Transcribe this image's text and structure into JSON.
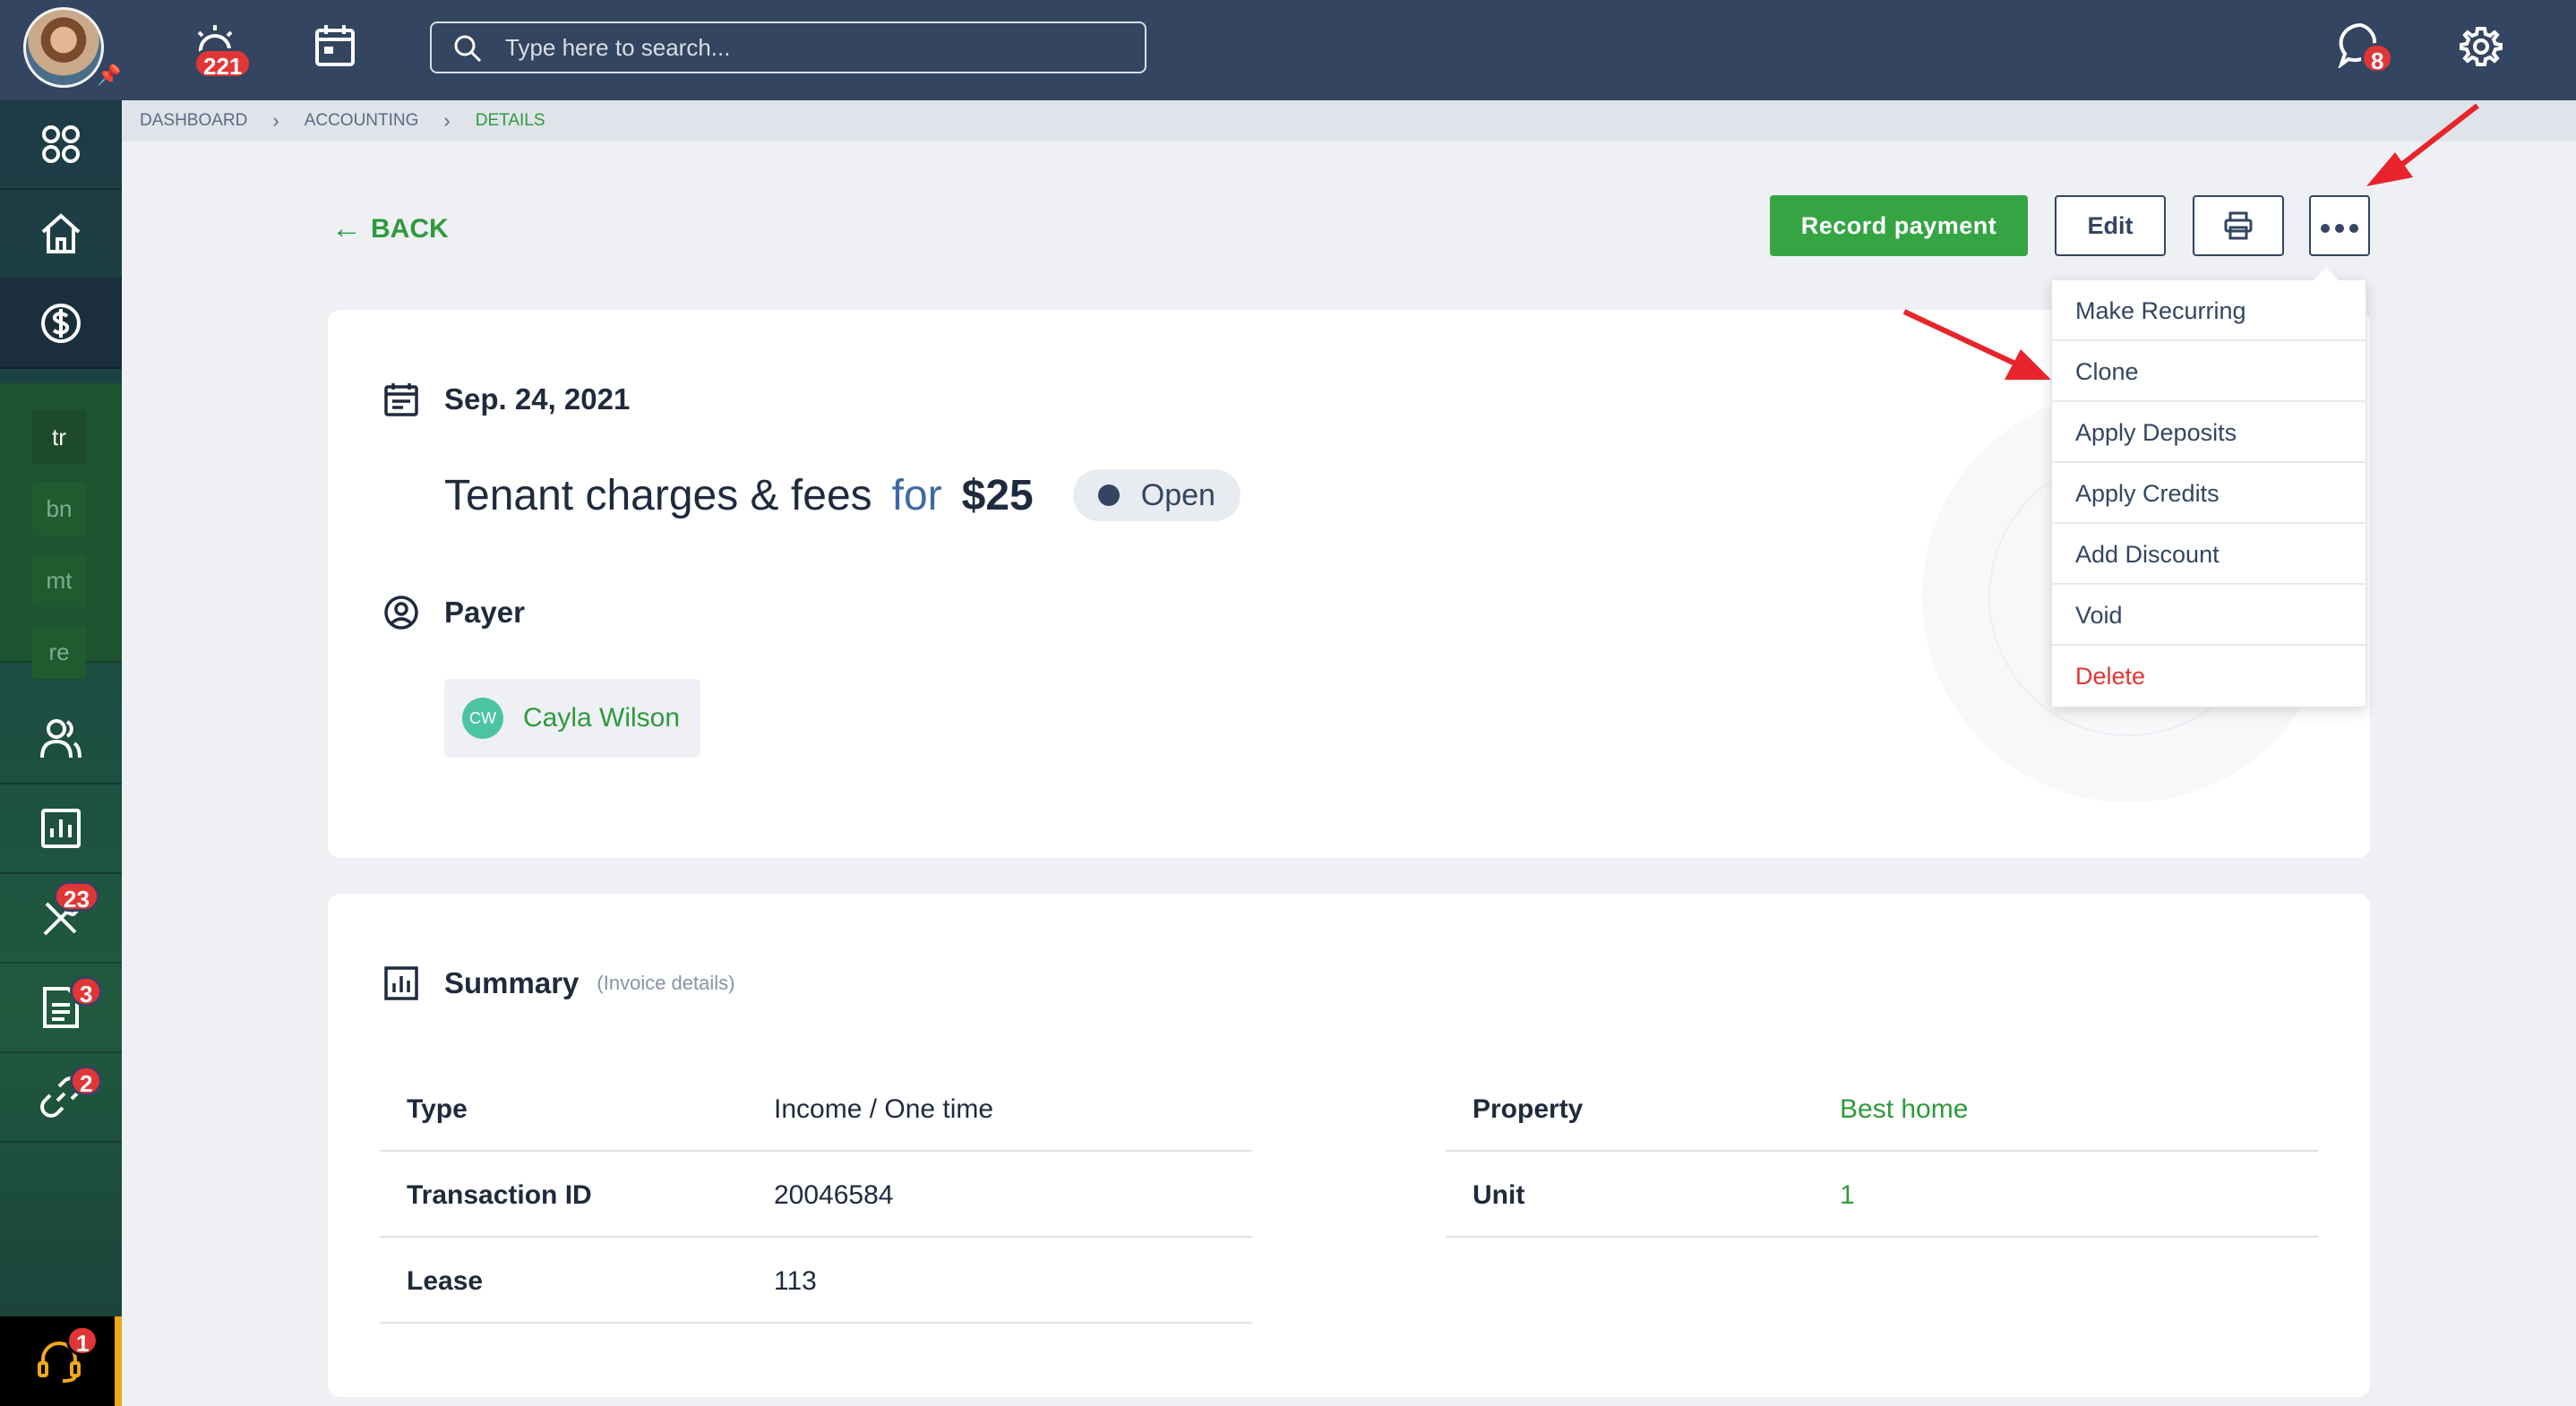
{
  "topbar": {
    "alerts_count": "221",
    "messages_count": "8",
    "search_placeholder": "Type here to search..."
  },
  "sidebar": {
    "tags": [
      "tr",
      "bn",
      "mt",
      "re"
    ],
    "maintenance_count": "23",
    "documents_count": "3",
    "links_count": "2",
    "support_count": "1"
  },
  "breadcrumb": {
    "items": [
      "DASHBOARD",
      "ACCOUNTING",
      "DETAILS"
    ]
  },
  "actions": {
    "back_label": "BACK",
    "record_payment_label": "Record payment",
    "edit_label": "Edit"
  },
  "details": {
    "date": "Sep. 24, 2021",
    "title": "Tenant charges & fees",
    "for_label": "for",
    "amount": "$25",
    "status": "Open",
    "payer_heading": "Payer",
    "payer_initials": "CW",
    "payer_name": "Cayla Wilson"
  },
  "menu": {
    "items": [
      "Make Recurring",
      "Clone",
      "Apply Deposits",
      "Apply Credits",
      "Add Discount",
      "Void",
      "Delete"
    ]
  },
  "summary": {
    "heading": "Summary",
    "subheading": "(Invoice details)",
    "left": [
      {
        "label": "Type",
        "value": "Income / One time"
      },
      {
        "label": "Transaction ID",
        "value": "20046584"
      },
      {
        "label": "Lease",
        "value": "113"
      }
    ],
    "right": [
      {
        "label": "Property",
        "value": "Best home"
      },
      {
        "label": "Unit",
        "value": "1"
      }
    ]
  },
  "colors": {
    "topbar": "#334560",
    "accent_green": "#35a544",
    "badge_red": "#e03636",
    "annotation_red": "#e8242a"
  }
}
